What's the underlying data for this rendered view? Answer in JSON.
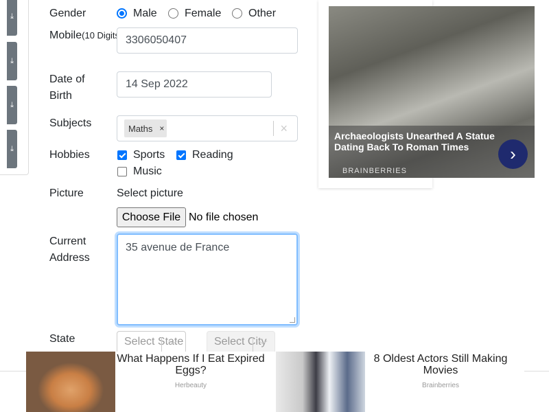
{
  "form": {
    "gender_label": "Gender",
    "gender_options": [
      "Male",
      "Female",
      "Other"
    ],
    "gender_selected": "Male",
    "mobile_label": "Mobile",
    "mobile_hint": "(10 Digits)",
    "mobile_value": "3306050407",
    "dob_label_line1": "Date of",
    "dob_label_line2": "Birth",
    "dob_value": "14 Sep 2022",
    "subjects_label": "Subjects",
    "subjects_chip": "Maths",
    "chip_remove": "×",
    "subjects_clear": "×",
    "hobbies_label": "Hobbies",
    "hobbies": [
      {
        "label": "Sports",
        "checked": true
      },
      {
        "label": "Reading",
        "checked": true
      },
      {
        "label": "Music",
        "checked": false
      }
    ],
    "picture_label": "Picture",
    "picture_select_text": "Select picture",
    "choose_file_button": "Choose File",
    "no_file_text": "No file chosen",
    "address_label_line1": "Current",
    "address_label_line2": "Address",
    "address_value": "35 avenue de France",
    "state_label": "State",
    "state_placeholder": "Select State",
    "city_placeholder": "Select City"
  },
  "side_icons": [
    "download-icon",
    "download-icon",
    "download-icon",
    "download-icon"
  ],
  "ad_right": {
    "title": "Archaeologists Unearthed A Statue Dating Back To Roman Times",
    "brand": "BRAINBERRIES",
    "arrow": "›"
  },
  "ad_bottom": [
    {
      "title": "What Happens If I Eat Expired Eggs?",
      "source": "Herbeauty"
    },
    {
      "title": "8 Oldest Actors Still Making Movies",
      "source": "Brainberries"
    }
  ],
  "colors": {
    "accent": "#0075ff",
    "focus": "#80bdff",
    "ad_arrow": "#1f2a6e"
  }
}
